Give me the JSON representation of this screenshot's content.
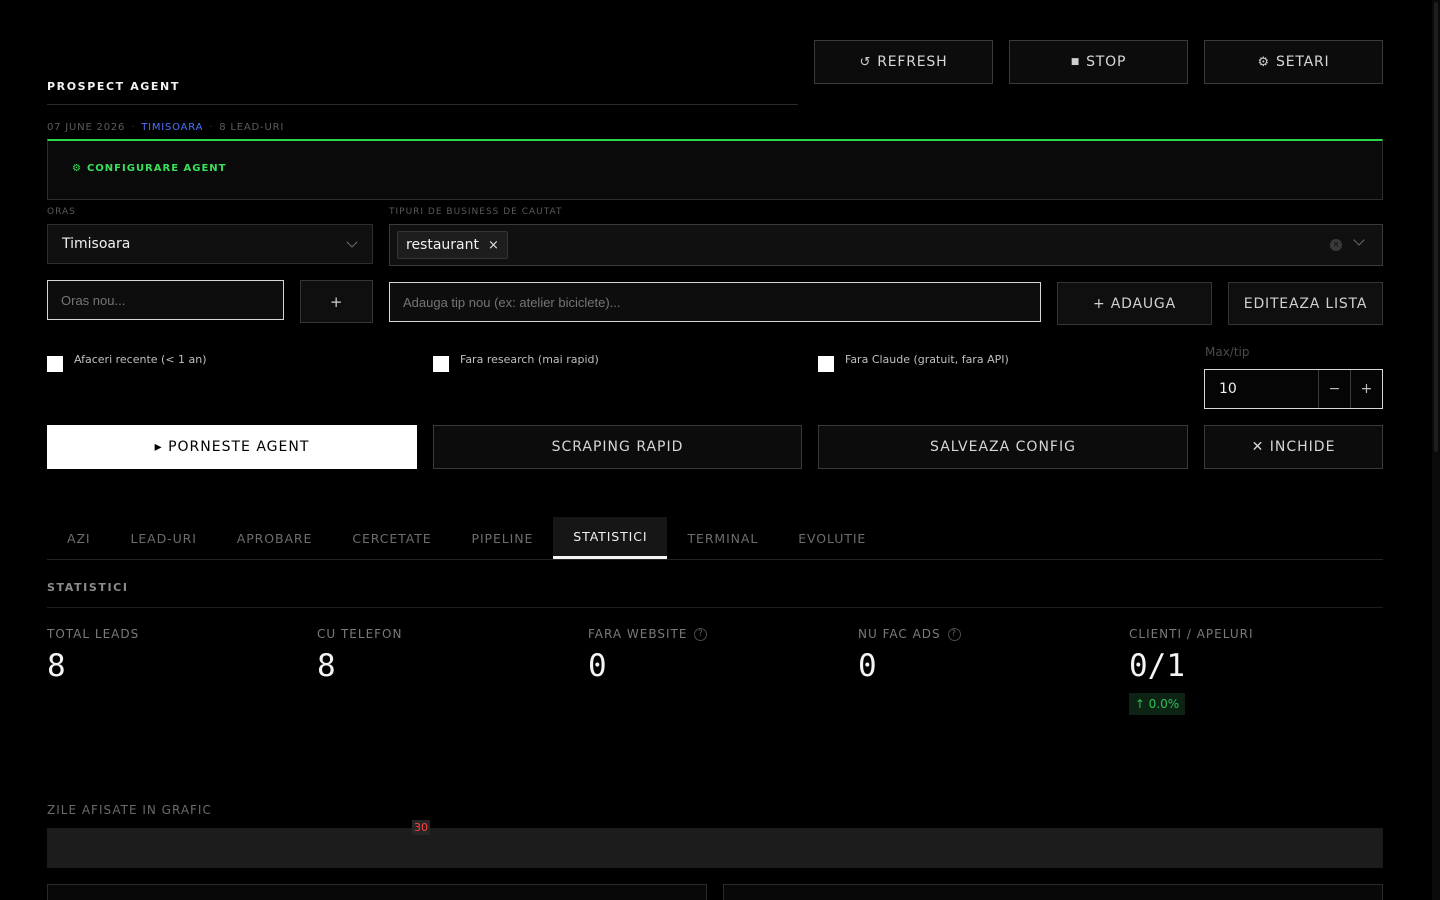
{
  "header": {
    "title": "PROSPECT AGENT",
    "date": "07 JUNE 2026",
    "city": "TIMISOARA",
    "leads_count": "8 LEAD-URI",
    "separator": "·"
  },
  "top_buttons": {
    "refresh_icon": "↺",
    "refresh": "REFRESH",
    "stop_icon": "■",
    "stop": "STOP",
    "settings_icon": "⚙",
    "settings": "SETARI"
  },
  "config": {
    "title_icon": "⚙",
    "title": "CONFIGURARE AGENT",
    "city_label": "ORAS",
    "city_value": "Timisoara",
    "types_label": "TIPURI DE BUSINESS DE CAUTAT",
    "type_tags": [
      "restaurant"
    ],
    "tag_remove": "×",
    "new_city_placeholder": "Oras nou...",
    "add_city": "+",
    "new_type_placeholder": "Adauga tip nou (ex: atelier biciclete)...",
    "add_type": "+ ADAUGA",
    "edit_list": "EDITEAZA LISTA",
    "checkbox_recent": "Afaceri recente (< 1 an)",
    "checkbox_no_research": "Fara research (mai rapid)",
    "checkbox_no_claude": "Fara Claude (gratuit, fara API)",
    "max_label": "Max/tip",
    "max_value": "10",
    "minus": "−",
    "plus": "+"
  },
  "actions": {
    "start": "▸ PORNESTE AGENT",
    "scrape": "SCRAPING RAPID",
    "save": "SALVEAZA CONFIG",
    "close": "✕ INCHIDE"
  },
  "tabs": [
    "AZI",
    "LEAD-URI",
    "APROBARE",
    "CERCETATE",
    "PIPELINE",
    "STATISTICI",
    "TERMINAL",
    "EVOLUTIE"
  ],
  "active_tab": "STATISTICI",
  "stats": {
    "section_title": "STATISTICI",
    "total_label": "TOTAL LEADS",
    "total_value": "8",
    "phone_label": "CU TELEFON",
    "phone_value": "8",
    "no_site_label": "FARA WEBSITE",
    "no_site_value": "0",
    "no_ads_label": "NU FAC ADS",
    "no_ads_value": "0",
    "clients_label": "CLIENTI / APELURI",
    "clients_value": "0/1",
    "help_icon": "?",
    "delta": "↑ 0.0%"
  },
  "chart_days": {
    "label": "ZILE AFISATE IN GRAFIC",
    "value": "30"
  },
  "colors": {
    "accent_green": "#2bd94a",
    "city_blue": "#4b73ff",
    "days_red": "#ff4040"
  }
}
